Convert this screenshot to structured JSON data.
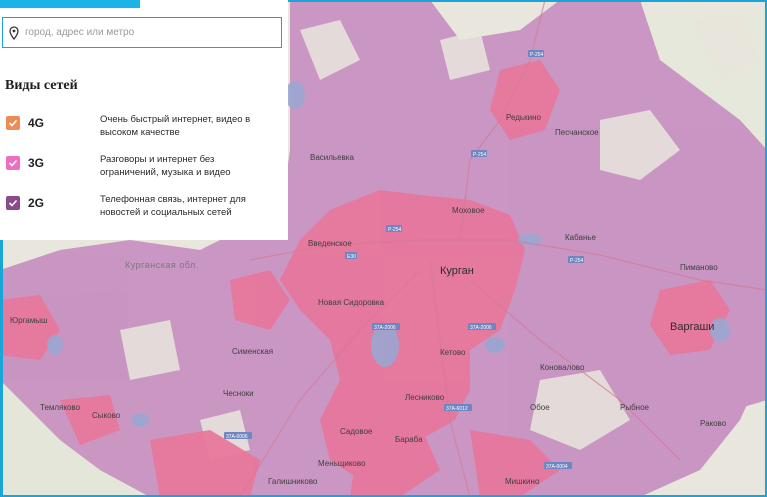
{
  "search": {
    "placeholder": "город, адрес или метро",
    "icon": "map-pin-icon"
  },
  "legend": {
    "title": "Виды сетей",
    "items": [
      {
        "label": "4G",
        "description": "Очень быстрый интернет, видео в высоком качестве",
        "color": "#ec8d58",
        "checked": true
      },
      {
        "label": "3G",
        "description": "Разговоры и интернет без ограничений, музыка и видео",
        "color": "#ee6ec2",
        "checked": true
      },
      {
        "label": "2G",
        "description": "Телефонная связь, интернет для новостей и социальных сетей",
        "color": "#8c4a8c",
        "checked": true
      }
    ]
  },
  "map": {
    "colors": {
      "base": "#e9e6dd",
      "coverage_2g": "#c68dc0",
      "coverage_3g": "#e7769b",
      "water": "#9aa6d2",
      "accent": "#1aa5d8"
    },
    "places": {
      "kurgan": "Курган",
      "vargashi": "Варгаши",
      "region": "Курганская обл.",
      "yurgamysh": "Юргамыш",
      "ketovo": "Кетово",
      "redkino": "Редькино",
      "peschanskoe": "Песчанское",
      "vvedenskoe": "Введенское",
      "mokhovoe": "Моховое",
      "novaya_sidorovka": "Новая Сидоровка",
      "lesnikovo": "Лесниково",
      "baraba": "Барабa",
      "sadovoe": "Садовое",
      "menshikovo": "Меньщиково",
      "mishkino": "Мишкино",
      "galishnikovo": "Галишниково",
      "chesnoki": "Чесноки",
      "simenskaya": "Сименская",
      "sykovo": "Сыково",
      "temlyakovo": "Темляково",
      "pimanovo": "Пиманово",
      "kabanie": "Кабанье",
      "vasilievka": "Васильевка",
      "oboe": "Обое",
      "rybnoe": "Рыбное",
      "rakovo": "Раково",
      "konovalovo": "Коновалово"
    },
    "roads": [
      "Р-254",
      "Р-254",
      "Р-254",
      "Р-254",
      "37А-2006",
      "37А-2006",
      "37А-6012",
      "37А-0006",
      "37А-0004",
      "Е30"
    ]
  }
}
